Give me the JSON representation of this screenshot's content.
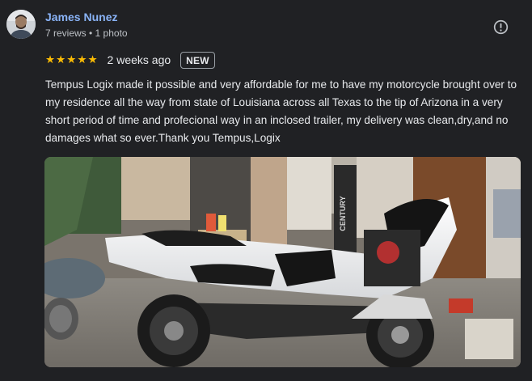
{
  "reviewer": {
    "name": "James Nunez",
    "meta": "7 reviews • 1 photo",
    "avatar_icon": "profile-avatar"
  },
  "review": {
    "rating": 5,
    "stars": [
      "★",
      "★",
      "★",
      "★",
      "★"
    ],
    "date": "2 weeks ago",
    "badge": "NEW",
    "text": "Tempus Logix made it possible and very affordable for me to have my motorcycle brought over to my residence all the way from state of Louisiana across all Texas to the tip of Arizona in a very short period of time and profecional way in an inclosed trailer, my delivery was clean,dry,and no damages what so ever.Thank you Tempus,Logix"
  },
  "photo": {
    "sign_text": "CENTURY",
    "description_icon": "review-photo-motorcycle"
  },
  "icons": {
    "report": "report-flag-icon",
    "star": "star-icon"
  },
  "colors": {
    "background": "#202124",
    "name_link": "#8ab4f8",
    "star": "#fbbc04",
    "text_primary": "#e8eaed",
    "text_secondary": "#bdc1c6"
  }
}
